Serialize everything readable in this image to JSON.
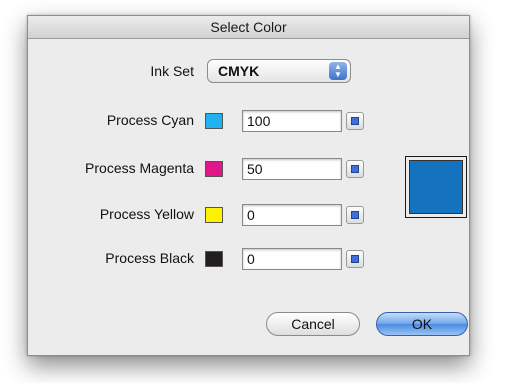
{
  "dialog": {
    "title": "Select Color"
  },
  "ink_set": {
    "label": "Ink Set",
    "value": "CMYK"
  },
  "inks": [
    {
      "label": "Process Cyan",
      "value": "100",
      "color": "#1fb2ec"
    },
    {
      "label": "Process Magenta",
      "value": "50",
      "color": "#e3158b"
    },
    {
      "label": "Process Yellow",
      "value": "0",
      "color": "#fff200"
    },
    {
      "label": "Process Black",
      "value": "0",
      "color": "#231f20"
    }
  ],
  "preview": {
    "color": "#1472bf"
  },
  "buttons": {
    "cancel": "Cancel",
    "ok": "OK"
  }
}
